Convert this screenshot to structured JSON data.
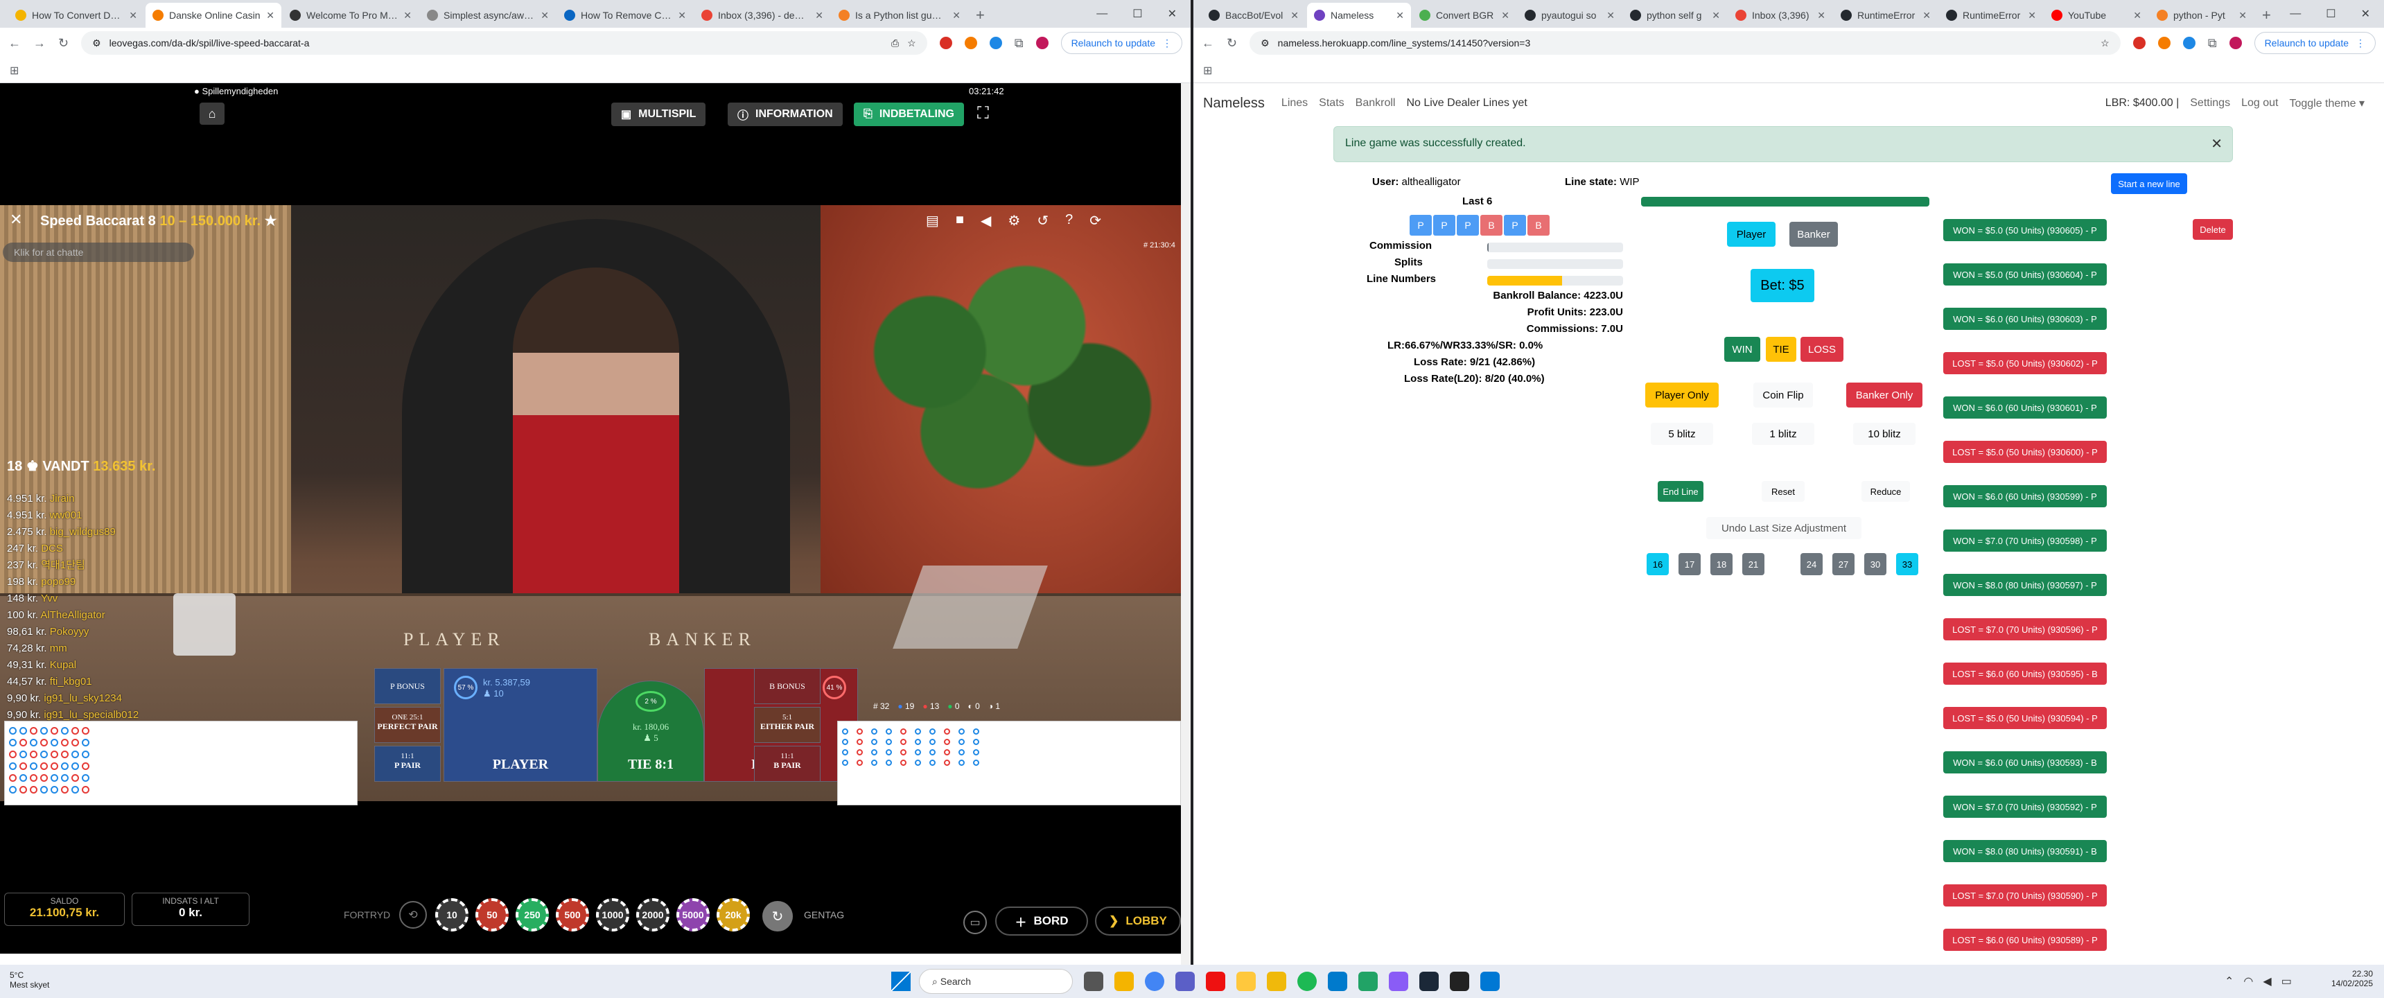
{
  "left": {
    "tabs": [
      {
        "title": "How To Convert Data Typ",
        "color": "#f4b400"
      },
      {
        "title": "Danske Online Casin",
        "color": "#f57c00"
      },
      {
        "title": "Welcome To Pro Mode",
        "color": "#333333"
      },
      {
        "title": "Simplest async/await exa",
        "color": "#888888"
      },
      {
        "title": "How To Remove Characte",
        "color": "#0a66c2"
      },
      {
        "title": "Inbox (3,396) - dennisasm",
        "color": "#ea4335"
      },
      {
        "title": "Is a Python list guarantee",
        "color": "#f48024"
      }
    ],
    "url": "leovegas.com/da-dk/spil/live-speed-baccarat-a",
    "relaunch": "Relaunch to update"
  },
  "game": {
    "regulator": "Spillemyndigheden",
    "clock": "03:21:42",
    "multispil": "MULTISPIL",
    "information": "INFORMATION",
    "indbetaling": "INDBETALING",
    "table_title": "Speed Baccarat 8",
    "table_limits": "10 – 150.000 kr.",
    "chat_placeholder": "Klik for at chatte",
    "time_small": "# 21:30:4",
    "winners_count": "18",
    "winners_label": "VANDT",
    "winners_amount": "13.635 kr.",
    "chat": [
      {
        "amount": "4.951 kr.",
        "name": "Jirain"
      },
      {
        "amount": "4.951 kr.",
        "name": "ww001"
      },
      {
        "amount": "2.475 kr.",
        "name": "big_wildgus89"
      },
      {
        "amount": "247 kr.",
        "name": "DCS"
      },
      {
        "amount": "237 kr.",
        "name": "역대1단팀"
      },
      {
        "amount": "198 kr.",
        "name": "popo99"
      },
      {
        "amount": "148 kr.",
        "name": "Yvv"
      },
      {
        "amount": "100 kr.",
        "name": "AlTheAlligator"
      },
      {
        "amount": "98,61 kr.",
        "name": "Pokoyyy"
      },
      {
        "amount": "74,28 kr.",
        "name": "mm"
      },
      {
        "amount": "49,31 kr.",
        "name": "Kupal"
      },
      {
        "amount": "44,57 kr.",
        "name": "fti_kbg01"
      },
      {
        "amount": "9,90 kr.",
        "name": "ig91_lu_sky1234"
      },
      {
        "amount": "9,90 kr.",
        "name": "ig91_lu_specialb012"
      }
    ],
    "table_word_player": "PLAYER",
    "table_word_banker": "BANKER",
    "p_bonus": "P BONUS",
    "b_bonus": "B BONUS",
    "perfect_pair_odds": "ONE 25:1",
    "perfect_pair": "PERFECT PAIR",
    "either_pair_odds": "5:1",
    "either_pair": "EITHER PAIR",
    "p_pair_odds": "11:1",
    "p_pair": "P PAIR",
    "b_pair_odds": "11:1",
    "b_pair": "B PAIR",
    "player_pct": "57 %",
    "player_amount": "kr. 5.387,59",
    "player_count": "10",
    "tie_pct": "2 %",
    "tie_amount": "kr. 180,06",
    "tie_count": "5",
    "bank_pct": "41 %",
    "player_label": "PLAYER",
    "tie_label": "TIE 8:1",
    "banker_label": "BANKER",
    "shoe_count": "# 32",
    "p_count": "19",
    "b_count": "13",
    "t_count": "0",
    "pp_count": "0",
    "bp_count": "1",
    "undo": "FORTRYD",
    "repeat": "GENTAG",
    "chips": [
      {
        "label": "10",
        "color": "#3a3a3a"
      },
      {
        "label": "50",
        "color": "#c0392b"
      },
      {
        "label": "250",
        "color": "#27ae60"
      },
      {
        "label": "500",
        "color": "#c0392b"
      },
      {
        "label": "1000",
        "color": "#333333"
      },
      {
        "label": "2000",
        "color": "#333333"
      },
      {
        "label": "5000",
        "color": "#8e44ad"
      },
      {
        "label": "20k",
        "color": "#d4a017"
      }
    ],
    "saldo_label": "SALDO",
    "saldo_value": "21.100,75 kr.",
    "stake_label": "INDSATS I ALT",
    "stake_value": "0 kr.",
    "bord": "BORD",
    "lobby": "LOBBY"
  },
  "right": {
    "tabs": [
      {
        "title": "BaccBot/Evol",
        "color": "#24292f"
      },
      {
        "title": "Nameless",
        "color": "#6f42c1"
      },
      {
        "title": "Convert BGR",
        "color": "#4caf50"
      },
      {
        "title": "pyautogui so",
        "color": "#24292f"
      },
      {
        "title": "python self g",
        "color": "#24292f"
      },
      {
        "title": "Inbox (3,396)",
        "color": "#ea4335"
      },
      {
        "title": "RuntimeError",
        "color": "#24292f"
      },
      {
        "title": "RuntimeError",
        "color": "#24292f"
      },
      {
        "title": "YouTube",
        "color": "#ff0000"
      },
      {
        "title": "python - Pyt",
        "color": "#f48024"
      }
    ],
    "url": "nameless.herokuapp.com/line_systems/141450?version=3",
    "relaunch": "Relaunch to update"
  },
  "app": {
    "brand": "Nameless",
    "nav": [
      "Lines",
      "Stats",
      "Bankroll"
    ],
    "nav_note": "No Live Dealer Lines yet",
    "lbr": "LBR: $400.00 |",
    "settings": "Settings",
    "logout": "Log out",
    "theme": "Toggle theme",
    "alert": "Line game was successfully created.",
    "user_label": "User:",
    "user": "althealligator",
    "state_label": "Line state:",
    "state": "WIP",
    "start_new": "Start a new line",
    "last6_label": "Last 6",
    "last6": [
      "P",
      "P",
      "P",
      "B",
      "P",
      "B"
    ],
    "commission_label": "Commission",
    "splits_label": "Splits",
    "linenums_label": "Line Numbers",
    "commission_level": 0.01,
    "splits_level": 0,
    "linenums_level": 0.55,
    "bankroll": "Bankroll Balance: 4223.0U",
    "profit": "Profit Units: 223.0U",
    "commissions": "Commissions: 7.0U",
    "ratios": "LR:66.67%/WR33.33%/SR: 0.0%",
    "loss_rate": "Loss Rate: 9/21 (42.86%)",
    "loss_rate20": "Loss Rate(L20): 8/20 (40.0%)",
    "player_btn": "Player",
    "banker_btn": "Banker",
    "bet": "Bet: $5",
    "win": "WIN",
    "tie": "TIE",
    "loss": "LOSS",
    "player_only": "Player Only",
    "coin_flip": "Coin Flip",
    "banker_only": "Banker Only",
    "blitz5": "5 blitz",
    "blitz1": "1 blitz",
    "blitz10": "10 blitz",
    "end_line": "End Line",
    "reset": "Reset",
    "reduce": "Reduce",
    "undo": "Undo Last Size Adjustment",
    "sizes": [
      "16",
      "17",
      "18",
      "21",
      "24",
      "27",
      "30",
      "33"
    ],
    "delete": "Delete",
    "results": [
      {
        "text": "WON = $5.0 (50 Units) (930605) - P",
        "won": true
      },
      {
        "text": "WON = $5.0 (50 Units) (930604) - P",
        "won": true
      },
      {
        "text": "WON = $6.0 (60 Units) (930603) - P",
        "won": true
      },
      {
        "text": "LOST = $5.0 (50 Units) (930602) - P",
        "won": false
      },
      {
        "text": "WON = $6.0 (60 Units) (930601) - P",
        "won": true
      },
      {
        "text": "LOST = $5.0 (50 Units) (930600) - P",
        "won": false
      },
      {
        "text": "WON = $6.0 (60 Units) (930599) - P",
        "won": true
      },
      {
        "text": "WON = $7.0 (70 Units) (930598) - P",
        "won": true
      },
      {
        "text": "WON = $8.0 (80 Units) (930597) - P",
        "won": true
      },
      {
        "text": "LOST = $7.0 (70 Units) (930596) - P",
        "won": false
      },
      {
        "text": "LOST = $6.0 (60 Units) (930595) - B",
        "won": false
      },
      {
        "text": "LOST = $5.0 (50 Units) (930594) - P",
        "won": false
      },
      {
        "text": "WON = $6.0 (60 Units) (930593) - B",
        "won": true
      },
      {
        "text": "WON = $7.0 (70 Units) (930592) - P",
        "won": true
      },
      {
        "text": "WON = $8.0 (80 Units) (930591) - B",
        "won": true
      },
      {
        "text": "LOST = $7.0 (70 Units) (930590) - P",
        "won": false
      },
      {
        "text": "LOST = $6.0 (60 Units) (930589) - P",
        "won": false
      }
    ]
  },
  "taskbar": {
    "temp": "5°C",
    "weather": "Mest skyet",
    "search": "Search",
    "time": "22.30",
    "date": "14/02/2025"
  }
}
